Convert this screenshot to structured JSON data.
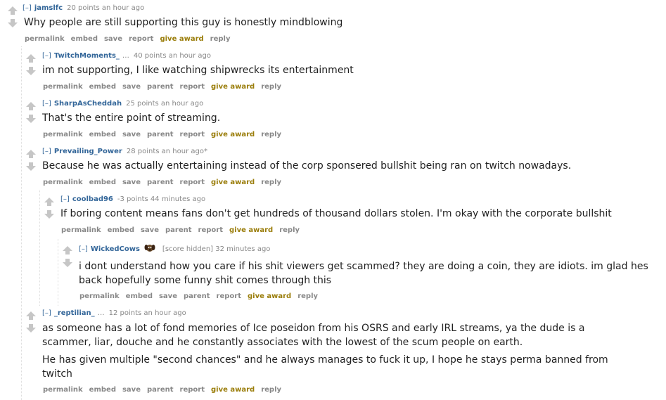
{
  "ui": {
    "expand_label": "[–]",
    "colors": {
      "author": "#336699",
      "meta": "#888888",
      "award": "#9a7d0a",
      "arrow": "#c6c6c6"
    }
  },
  "comments": [
    {
      "author": "jamslfc",
      "score_time": "20 points an hour ago",
      "body": [
        "Why people are still supporting this guy is honestly mindblowing"
      ],
      "buttons": [
        "permalink",
        "embed",
        "save",
        "report",
        "give award",
        "reply"
      ]
    },
    {
      "author": "TwitchMoments_",
      "author_suffix": "…",
      "score_time": "40 points an hour ago",
      "body": [
        "im not supporting, I like watching shipwrecks its entertainment"
      ],
      "buttons": [
        "permalink",
        "embed",
        "save",
        "parent",
        "report",
        "give award",
        "reply"
      ]
    },
    {
      "author": "SharpAsCheddah",
      "score_time": "25 points an hour ago",
      "body": [
        "That's the entire point of streaming."
      ],
      "buttons": [
        "permalink",
        "embed",
        "save",
        "parent",
        "report",
        "give award",
        "reply"
      ]
    },
    {
      "author": "Prevailing_Power",
      "score_time": "28 points an hour ago*",
      "body": [
        "Because he was actually entertaining instead of the corp sponsered bullshit being ran on twitch nowadays."
      ],
      "buttons": [
        "permalink",
        "embed",
        "save",
        "parent",
        "report",
        "give award",
        "reply"
      ]
    },
    {
      "author": "coolbad96",
      "score_time": "-3 points 44 minutes ago",
      "body": [
        "If boring content means fans don't get hundreds of thousand dollars stolen. I'm okay with the corporate bullshit"
      ],
      "buttons": [
        "permalink",
        "embed",
        "save",
        "parent",
        "report",
        "give award",
        "reply"
      ]
    },
    {
      "author": "WickedCows",
      "flair": "dog-flair-icon",
      "score_time": "[score hidden] 32 minutes ago",
      "body": [
        "i dont understand how you care if his shit viewers get scammed? they are doing a coin, they are idiots. im glad hes back hopefully some funny shit comes through this"
      ],
      "buttons": [
        "permalink",
        "embed",
        "save",
        "parent",
        "report",
        "give award",
        "reply"
      ]
    },
    {
      "author": "_reptilian_",
      "author_suffix": "…",
      "score_time": "12 points an hour ago",
      "body": [
        "as someone has a lot of fond memories of Ice poseidon from his OSRS and early IRL streams, ya the dude is a scammer, liar, douche and he constantly associates with the lowest of the scum people on earth.",
        "He has given multiple \"second chances\" and he always manages to fuck it up, I hope he stays perma banned from twitch"
      ],
      "buttons": [
        "permalink",
        "embed",
        "save",
        "parent",
        "report",
        "give award",
        "reply"
      ]
    }
  ]
}
